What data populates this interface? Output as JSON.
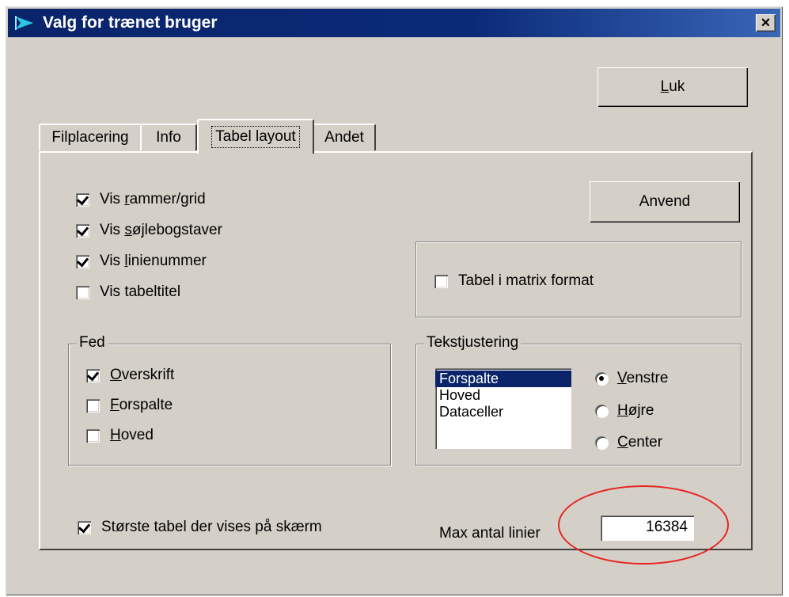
{
  "window": {
    "title": "Valg for trænet bruger",
    "close_glyph": "×",
    "icon": "flag-icon"
  },
  "buttons": {
    "close": {
      "pre": "",
      "accel": "L",
      "post": "uk"
    },
    "apply": {
      "label": "Anvend"
    }
  },
  "tabs": [
    {
      "label": "Filplacering"
    },
    {
      "label": "Info"
    },
    {
      "label": "Tabel layout",
      "active": true
    },
    {
      "label": "Andet"
    }
  ],
  "display": {
    "items": [
      {
        "pre": "Vis ",
        "accel": "r",
        "post": "ammer/grid",
        "checked": true
      },
      {
        "pre": "Vis ",
        "accel": "s",
        "post": "øjlebogstaver",
        "checked": true
      },
      {
        "pre": "Vis ",
        "accel": "l",
        "post": "inienummer",
        "checked": true
      },
      {
        "pre": "Vis tabeltitel",
        "accel": "",
        "post": "",
        "checked": false
      }
    ]
  },
  "matrix": {
    "label": "Tabel i matrix format",
    "checked": false
  },
  "bold": {
    "legend": "Fed",
    "items": [
      {
        "pre": "",
        "accel": "O",
        "post": "verskrift",
        "checked": true
      },
      {
        "pre": "",
        "accel": "F",
        "post": "orspalte",
        "checked": false
      },
      {
        "pre": "",
        "accel": "H",
        "post": "oved",
        "checked": false
      }
    ]
  },
  "alignment": {
    "legend": "Tekstjustering",
    "list": [
      "Forspalte",
      "Hoved",
      "Dataceller"
    ],
    "selected_index": 0,
    "options": [
      {
        "pre": "",
        "accel": "V",
        "post": "enstre",
        "selected": true
      },
      {
        "pre": "",
        "accel": "H",
        "post": "øjre",
        "selected": false
      },
      {
        "pre": "",
        "accel": "C",
        "post": "enter",
        "selected": false
      }
    ]
  },
  "largest": {
    "label": "Største tabel der vises på skærm",
    "checked": true
  },
  "max_lines": {
    "label": "Max antal linier",
    "value": "16384"
  },
  "colors": {
    "titlebar": "#0a246a",
    "face": "#d4d0c8",
    "selection": "#0a246a",
    "highlight_ellipse": "#e8231f"
  }
}
